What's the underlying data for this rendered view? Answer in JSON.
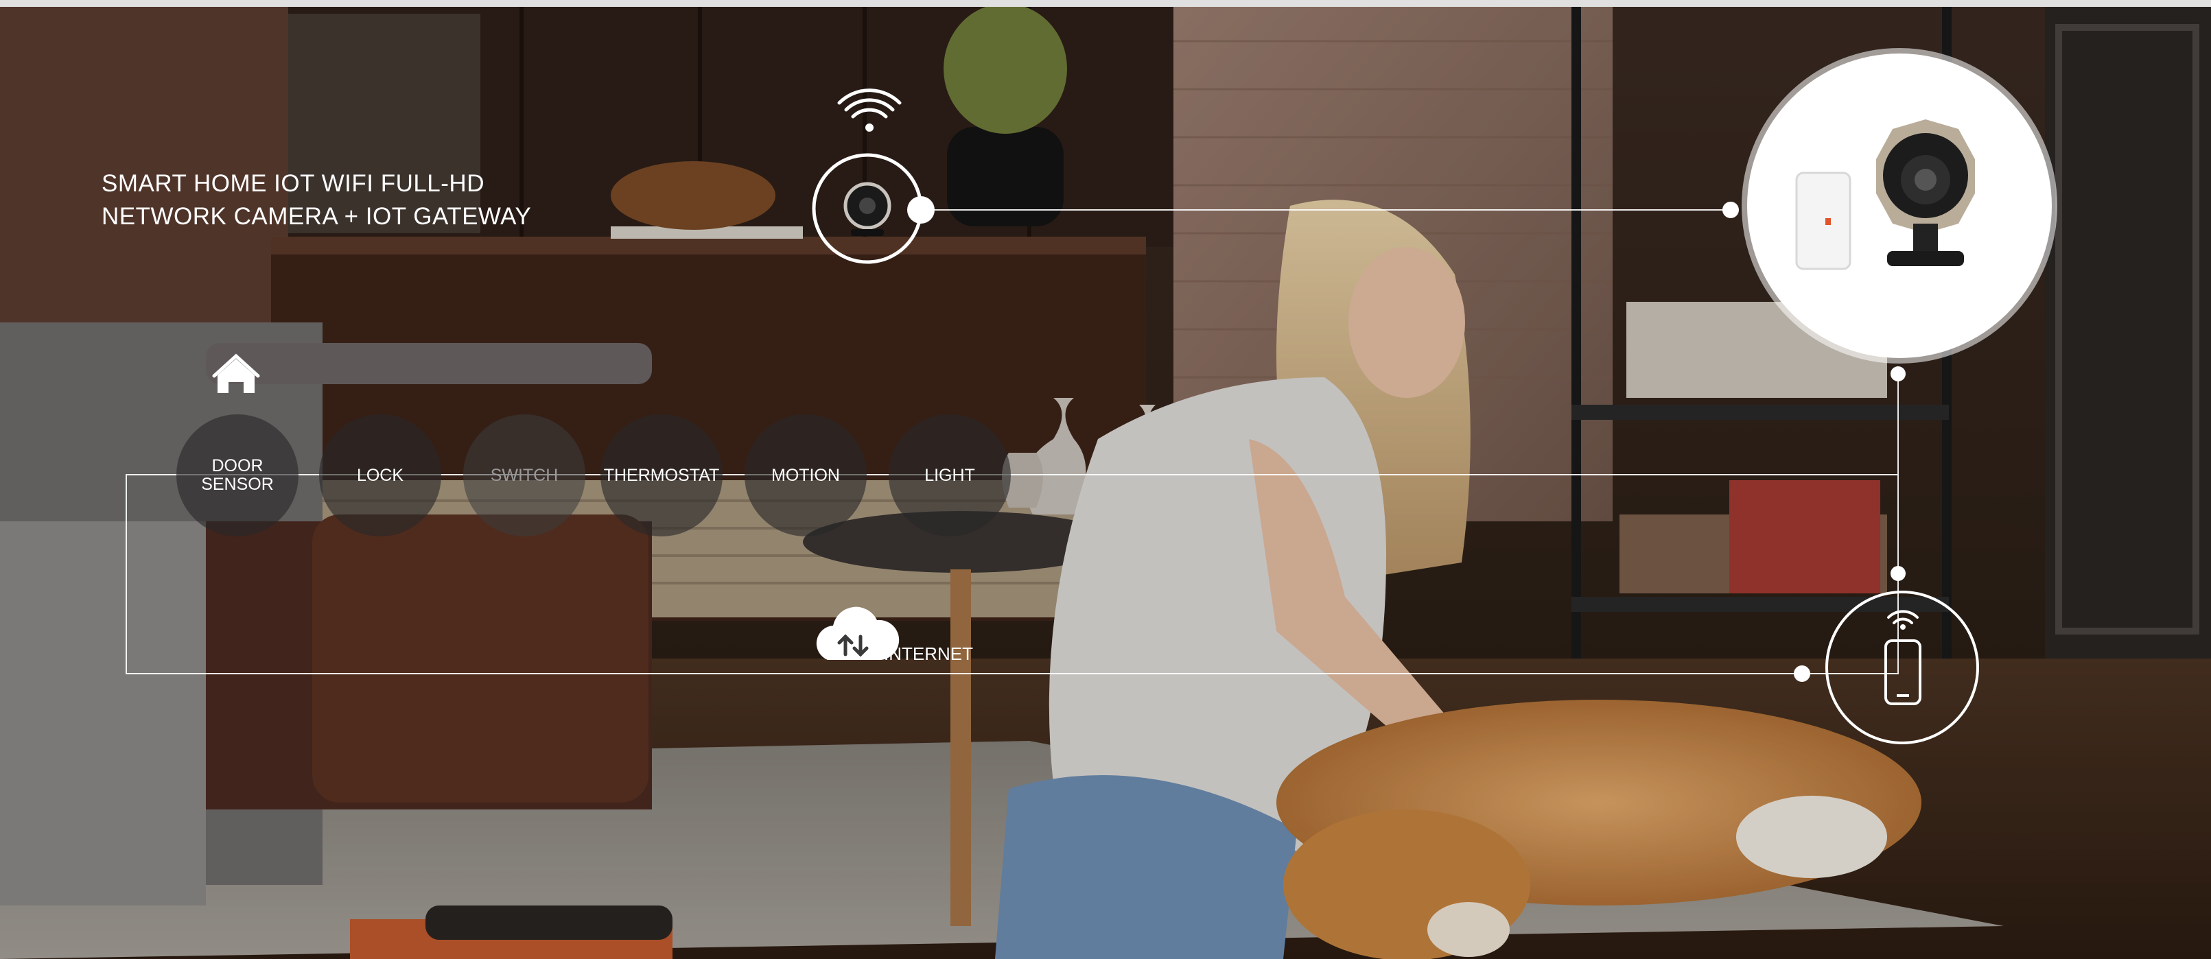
{
  "headline": {
    "line1": "SMART HOME IOT WIFI FULL-HD",
    "line2": "NETWORK CAMERA + IOT GATEWAY"
  },
  "sensors": [
    {
      "label": "DOOR\nSENSOR",
      "dimmed": false
    },
    {
      "label": "LOCK",
      "dimmed": false
    },
    {
      "label": "SWITCH",
      "dimmed": true
    },
    {
      "label": "THERMOSTAT",
      "dimmed": false
    },
    {
      "label": "MOTION",
      "dimmed": false
    },
    {
      "label": "LIGHT",
      "dimmed": false
    }
  ],
  "internet": {
    "label": "INTERNET"
  },
  "icons": [
    "wifi-icon",
    "camera-icon",
    "home-icon",
    "cloud-sync-icon",
    "smartphone-icon",
    "gateway-device-icon"
  ],
  "colors": {
    "overlay": "#ffffff",
    "sensor_fill": "#2b2b2b",
    "dimmed_text": "#9a9a9a"
  }
}
